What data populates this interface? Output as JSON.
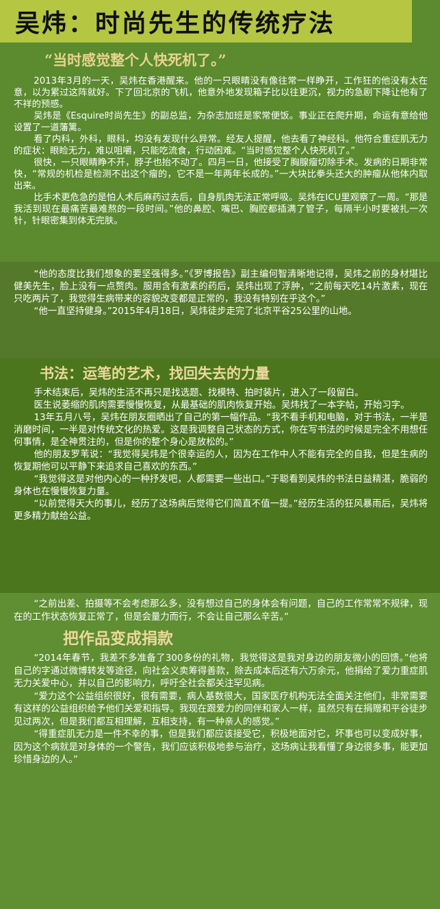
{
  "title": "吴炜：时尚先生的传统疗法",
  "quote1": "“当时感觉整个人快死机了。”",
  "part1": [
    "2013年3月的一天，吴炜在香港醒来。他的一只眼睛没有像往常一样睁开，工作狂的他没有太在意，以为累过这阵就好。下了回北京的飞机，他意外地发现箱子比以往更沉，视力的急剧下降让他有了不祥的预感。",
    "吴炜是《Esquire时尚先生》的副总监，为杂志加班是家常便饭。事业正在爬升期，命运有意给他设置了一道藩篱。",
    "看了内科，外科，眼科，均没有发现什么异常。经友人提醒，他去看了神经科。他符合重症肌无力的症状：眼睑无力，难以咀嚼，只能吃流食，行动困难。“当时感觉整个人快死机了。”",
    "很快，一只眼睛睁不开，脖子也抬不动了。四月一日，他接受了胸腺瘤切除手术。发病的日期非常快，“常规的机检是检测不出这个瘤的，它不是一年两年长成的。”一大块比拳头还大的肿瘤从他体内取出来。",
    "比手术更危急的是怕人术后麻药过去后，自身肌肉无法正常呼吸。吴炜在ICU里观察了一周。“那是我活到现在最痛苦最难熬的一段时间。”他的鼻腔、嘴巴、胸腔都插满了管子，每隔半小时要被扎一次针，针眼密集到体无完肤。"
  ],
  "part2": [
    "“他的态度比我们想象的要坚强得多。”《罗博报告》副主编何智清晰地记得，吴炜之前的身材堪比健美先生，脸上没有一点赘肉。服用含有激素的药后，吴炜出现了浮肿，“之前每天吃14片激素，现在只吃两片了，我觉得生病带来的容貌改变都是正常的，我没有特别在乎这个。”",
    "“他一直坚持健身。”2015年4月18日，吴炜徒步走完了北京平谷25公里的山地。"
  ],
  "heading1": "书法：运笔的艺术，找回失去的力量",
  "part3": [
    "手术结束后，吴炜的生活不再只是找选题、找模特、拍时装片，进入了一段留白。",
    "医生说萎缩的肌肉需要慢慢恢复，从最基础的肌肉恢复开始。吴炜找了一本字帖，开始习字。",
    "13年五月八号，吴炜在朋友圈晒出了自己的第一幅作品。“我不看手机和电脑，对于书法，一半是消磨时间，一半是对传统文化的热爱。这是我调整自己状态的方式，你在写书法的时候是完全不用想任何事情，是全神贯注的，但是你的整个身心是放松的。”",
    "他的朋友罗苇说：“我觉得吴炜是个很幸运的人，因为在工作中人不能有完全的自我，但是生病的恢复期他可以平静下来追求自己喜欢的东西。”",
    "“我觉得这是对他内心的一种抒发吧，人都需要一些出口。”于聪看到吴炜的书法日益精湛，脆弱的身体也在慢慢恢复力量。",
    "“以前觉得天大的事儿，经历了这场病后觉得它们简直不值一提。”经历生活的狂风暴雨后，吴炜将更多精力献给公益。"
  ],
  "part4a": [
    "“之前出差、拍摄等不会考虑那么多，没有想过自己的身体会有问题，自己的工作常常不规律，现在的工作状态恢复正常了，但是会量力而行，不会让自己那么辛苦。”"
  ],
  "heading2": "把作品变成捐款",
  "part4b": [
    "“2014年春节，我差不多准备了300多份的礼物，我觉得这是我对身边的朋友微小的回馈。”他将自己的字通过微博转发等途径，向社会义卖筹得善款，除去成本后还有六万余元，他捐给了爱力重症肌无力关爱中心，并以自己的影响力，呼吁全社会都关注罕见病。",
    "“爱力这个公益组织很好，很有需要，病人基数很大，国家医疗机构无法全面关注他们，非常需要有这样的公益组织给予他们关爱和指导。我现在跟爱力的同伴和家人一样，虽然只有在捐赠和平谷徒步见过两次，但是我们都互相理解，互相支持，有一种亲人的感觉。”",
    "“得重症肌无力是一件不幸的事，但是我们都应该接受它，积极地面对它，坏事也可以变成好事，因为这个病就是对身体的一个警告，我们应该积极地参与治疗，这场病让我看懂了身边很多事，能更加珍惜身边的人。”"
  ],
  "colors": {
    "title_bar": "#b4c642",
    "background": "#5c8a2e",
    "heading": "#ecd89a"
  }
}
